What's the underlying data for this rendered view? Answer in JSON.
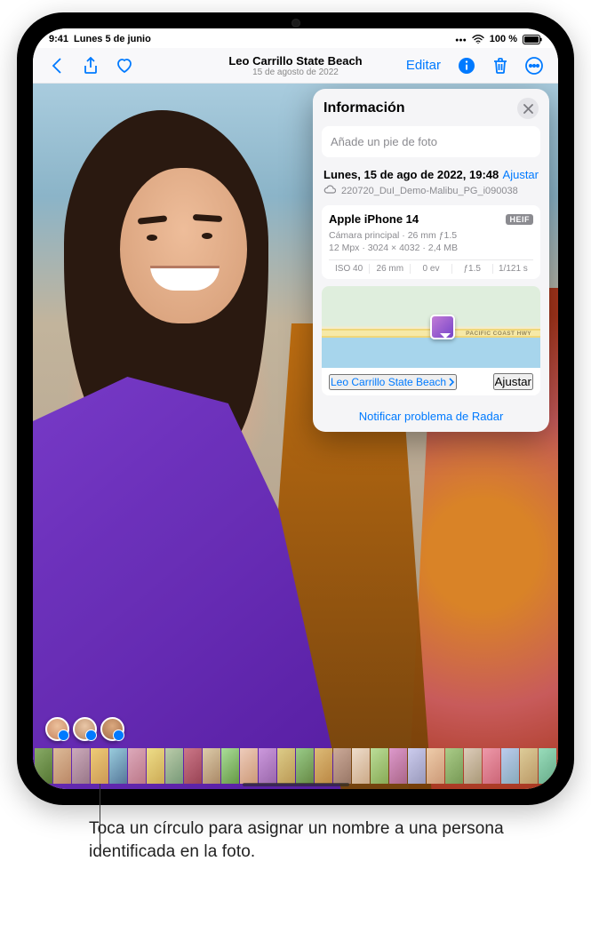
{
  "statusbar": {
    "time": "9:41",
    "date": "Lunes 5 de junio",
    "battery": "100 %"
  },
  "toolbar": {
    "title": "Leo Carrillo State Beach",
    "subtitle": "15 de agosto de 2022",
    "edit_label": "Editar"
  },
  "info": {
    "title": "Información",
    "caption_placeholder": "Añade un pie de foto",
    "datetime": "Lunes, 15 de ago de 2022, 19:48",
    "adjust_label": "Ajustar",
    "filename": "220720_DuI_Demo-Malibu_PG_i090038",
    "camera": {
      "device": "Apple iPhone 14",
      "format": "HEIF",
      "lens_line": "Cámara principal · 26 mm ƒ1.5",
      "meta_line": "12 Mpx · 3024 × 4032 · 2,4 MB",
      "iso": "ISO 40",
      "focal": "26 mm",
      "ev": "0 ev",
      "aperture": "ƒ1.5",
      "shutter": "1/121 s"
    },
    "map": {
      "road_label": "PACIFIC COAST HWY",
      "location_name": "Leo Carrillo State Beach",
      "adjust_label": "Ajustar"
    },
    "report_label": "Notificar problema de Radar"
  },
  "callout": {
    "text": "Toca un círculo para asignar un nombre a una persona identificada en la foto."
  }
}
